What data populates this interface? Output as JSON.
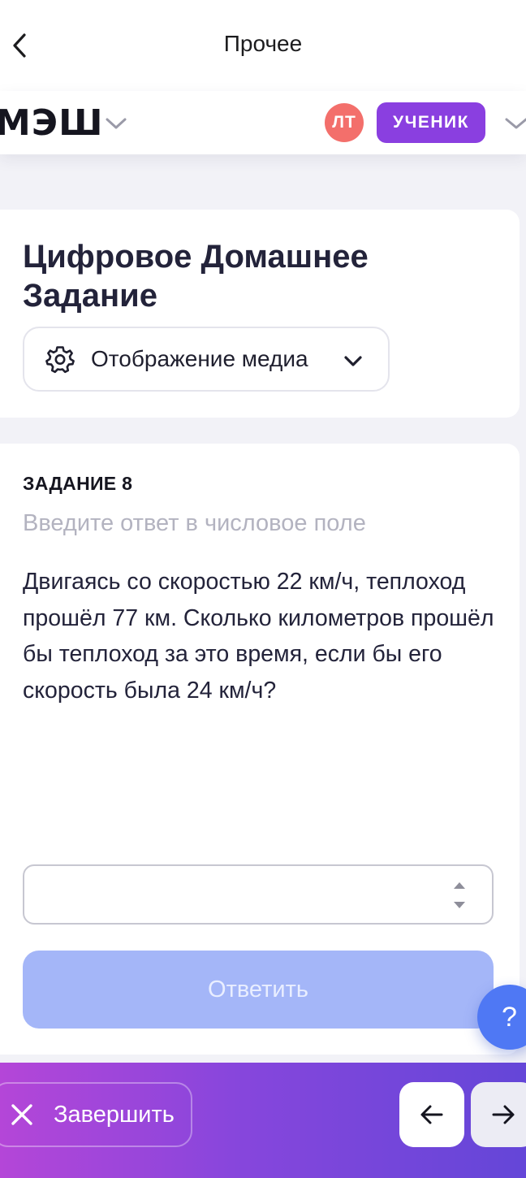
{
  "header": {
    "title": "Прочее"
  },
  "appbar": {
    "logo": "МЭШ",
    "avatar_initials": "ЛТ",
    "role_label": "УЧЕНИК",
    "avatar_color": "#f36f6b",
    "role_color": "#8a3fe0"
  },
  "main": {
    "page_title": "Цифровое Домашнее Задание",
    "media_select_label": "Отображение медиа"
  },
  "task": {
    "number_label": "ЗАДАНИЕ 8",
    "hint": "Введите ответ в числовое поле",
    "text": "Двигаясь со скоростью 22 км/ч, теплоход прошёл 77 км. Сколько километров прошёл бы теплоход за это время, если бы его скорость была 24 км/ч?",
    "answer_value": "",
    "submit_label": "Ответить"
  },
  "help": {
    "label": "?"
  },
  "footer": {
    "finish_label": "Завершить"
  },
  "icons": {
    "back": "chevron-left-icon",
    "logo_menu": "chevron-down-icon",
    "settings": "gear-icon",
    "finish": "close-icon",
    "prev": "arrow-left-icon",
    "next": "arrow-right-icon"
  },
  "colors": {
    "accent_button": "#a4b6f8",
    "help_button": "#4f78f4",
    "footer_gradient_start": "#b446d8",
    "footer_gradient_end": "#6446d8"
  }
}
